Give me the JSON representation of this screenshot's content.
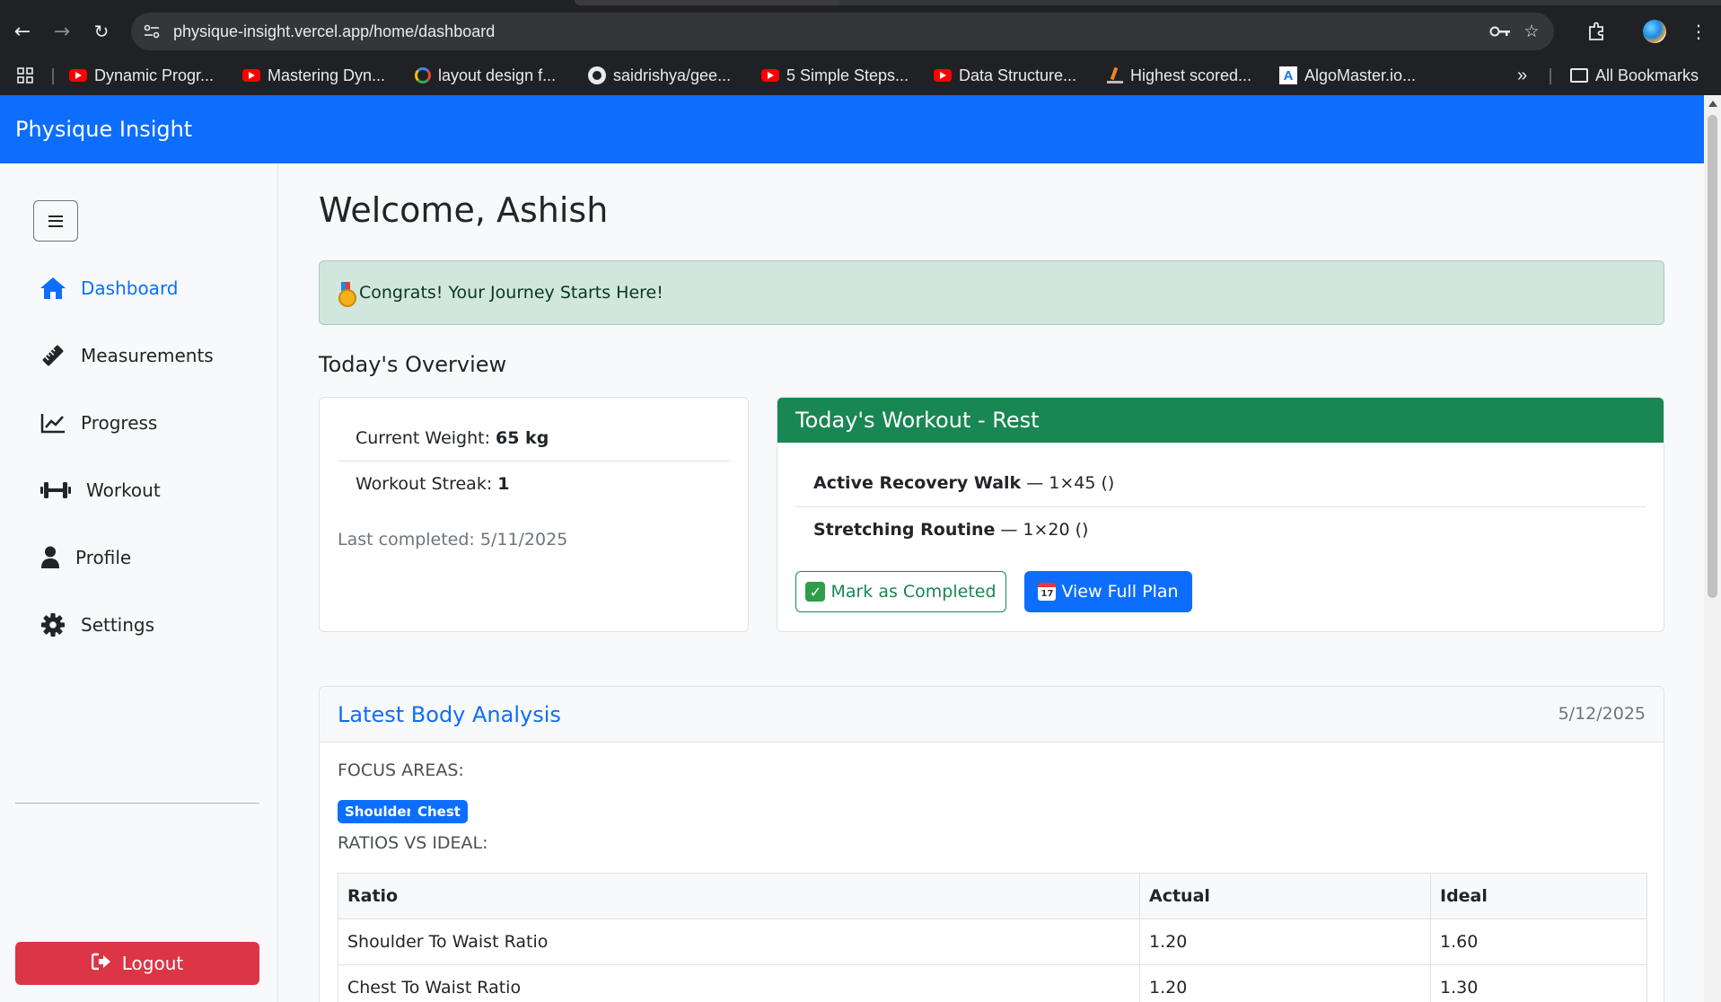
{
  "browser": {
    "url": "physique-insight.vercel.app/home/dashboard",
    "bookmarks": [
      {
        "label": "Dynamic Progr...",
        "icon": "youtube-icon"
      },
      {
        "label": "Mastering Dyn...",
        "icon": "youtube-icon"
      },
      {
        "label": "layout design f...",
        "icon": "google-icon"
      },
      {
        "label": "saidrishya/gee...",
        "icon": "github-icon"
      },
      {
        "label": "5 Simple Steps...",
        "icon": "youtube-icon"
      },
      {
        "label": "Data Structure...",
        "icon": "youtube-icon"
      },
      {
        "label": "Highest scored...",
        "icon": "stackoverflow-icon"
      },
      {
        "label": "AlgoMaster.io...",
        "icon": "algomaster-icon"
      }
    ],
    "overflow": "»",
    "all_bookmarks": "All Bookmarks"
  },
  "app": {
    "brand": "Physique Insight",
    "accent": "#0d6efd"
  },
  "sidebar": {
    "items": [
      {
        "label": "Dashboard",
        "icon": "home-icon",
        "active": true
      },
      {
        "label": "Measurements",
        "icon": "ruler-icon"
      },
      {
        "label": "Progress",
        "icon": "chart-line-icon"
      },
      {
        "label": "Workout",
        "icon": "dumbbell-icon"
      },
      {
        "label": "Profile",
        "icon": "user-icon"
      },
      {
        "label": "Settings",
        "icon": "gear-icon"
      }
    ],
    "logout_label": "Logout"
  },
  "main": {
    "welcome": "Welcome, Ashish",
    "alert": "Congrats! Your Journey Starts Here!",
    "overview_title": "Today's Overview",
    "stats": {
      "weight_label": "Current Weight:",
      "weight_value": "65 kg",
      "streak_label": "Workout Streak:",
      "streak_value": "1",
      "last_completed": "Last completed: 5/11/2025"
    },
    "workout": {
      "title": "Today's Workout - Rest",
      "exercises": [
        {
          "name": "Active Recovery Walk",
          "detail": "— 1×45 ()"
        },
        {
          "name": "Stretching Routine",
          "detail": "— 1×20 ()"
        }
      ],
      "mark_completed": "Mark as Completed",
      "view_plan": "View Full Plan",
      "header_color": "#198754"
    },
    "analysis": {
      "title": "Latest Body Analysis",
      "date": "5/12/2025",
      "focus_label": "FOCUS AREAS:",
      "focus_areas": [
        "Shoulders",
        "Chest"
      ],
      "ratios_label": "RATIOS VS IDEAL:",
      "table": {
        "headers": [
          "Ratio",
          "Actual",
          "Ideal"
        ],
        "rows": [
          [
            "Shoulder To Waist Ratio",
            "1.20",
            "1.60"
          ],
          [
            "Chest To Waist Ratio",
            "1.20",
            "1.30"
          ]
        ]
      }
    }
  }
}
